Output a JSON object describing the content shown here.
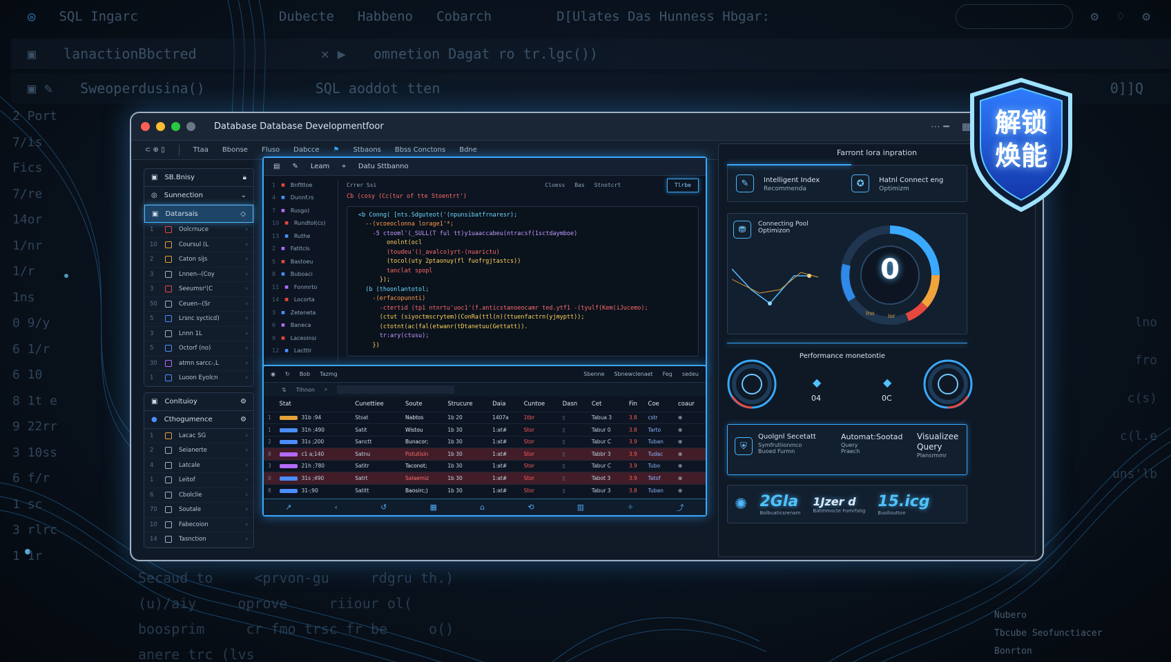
{
  "background": {
    "top_bar": [
      "SQL Ingarc",
      "Dubecte",
      "Habbeno",
      "Cobarch",
      "D[Ulates Das Hunness Hbgar:"
    ],
    "row1": "lanactionBbctred",
    "row1_code": "omnetion Dagat ro tr.lgc())",
    "row2": "Sweoperdusina()",
    "row2_code": "SQL aoddot tten",
    "row2_right": "0]]Q",
    "gutter": [
      "2  Port",
      "7/is",
      "Fics",
      "7/re",
      "14or",
      "1/nr",
      "1/r",
      "1ns",
      "0  9/y",
      "6  1/r",
      "6  10",
      "8  1t e",
      "9  22rr",
      "3  10ss",
      "6  f/r",
      "1  sc",
      "3  rlrc",
      "1  1r"
    ],
    "right_gutter": [
      "lno",
      "fro",
      "c(s)",
      "c(l.e",
      "uns'lb"
    ],
    "bottom_code": [
      [
        "Secaud to",
        "<prvon-gu",
        "rdgru th.)"
      ],
      [
        "(u)/aiy",
        "oprove",
        "riiour ol("
      ],
      [
        "boosprim",
        "cr fmo trsc fr be",
        "o()"
      ],
      [
        "",
        "anere trc (lvs",
        ""
      ]
    ],
    "bottom_right": [
      "Nubero",
      "Tbcube  Seofunctiacer",
      "Bonrton"
    ]
  },
  "window": {
    "title": "Database Database Developmentfoor",
    "toolbar": [
      "Ttaa",
      "Bbonse",
      "Fluso",
      "Dabcce",
      "Stbaons",
      "Bbss Conctons",
      "Bdne"
    ],
    "colors": {
      "close": "#ff5f57",
      "min": "#febc2e",
      "max": "#28c840",
      "accent": "#3aa9ff"
    }
  },
  "sidebar": {
    "header": "SB.Bnisy",
    "group1": "Sunnection",
    "group1_active": "Datarsais",
    "items": [
      {
        "n": "1",
        "label": "Oolcrnuce"
      },
      {
        "n": "10",
        "label": "Coursul (L"
      },
      {
        "n": "2",
        "label": "Caton sijs"
      },
      {
        "n": "3",
        "label": "Lnnen--(Coy"
      },
      {
        "n": "3",
        "label": "Seeumsr'(C"
      },
      {
        "n": "50",
        "label": "Ceuen--(Sr"
      },
      {
        "n": "5",
        "label": "Lrsnc sycticd)"
      },
      {
        "n": "3",
        "label": "Lnnn 1L"
      },
      {
        "n": "5",
        "label": "Octorf (no)"
      },
      {
        "n": "30",
        "label": "atmn sarcc-,L"
      },
      {
        "n": "1",
        "label": "Luoon Eyolcn"
      }
    ],
    "group2": "Conltuioy",
    "group3": "Cthogumence",
    "items2": [
      {
        "n": "1",
        "label": "Lacac SG"
      },
      {
        "n": "2",
        "label": "Seianerte"
      },
      {
        "n": "4",
        "label": "Latcale"
      },
      {
        "n": "1",
        "label": "Leitof"
      },
      {
        "n": "6",
        "label": "Cbolclie"
      },
      {
        "n": "70",
        "label": "Soutale"
      },
      {
        "n": "10",
        "label": "Fabecoion"
      },
      {
        "n": "14",
        "label": "Tasnction"
      }
    ]
  },
  "editor": {
    "tabs": [
      "Leam",
      "Datu Sttbanno"
    ],
    "files": [
      "Bnflttoe",
      "Dunnf.rs",
      "Rusgo)",
      "Rundtol(cs)",
      "Ruthe",
      "Fatitcls",
      "Bastoeu",
      "Buboaci",
      "Fonmrto",
      "Locorta",
      "Zeteneta",
      "Baneca",
      "Laceoinsi",
      "Lacttlr"
    ],
    "sub": [
      "Crrer Ssi",
      "Cloess",
      "Bas",
      "Stnotcrt"
    ],
    "run_label": "Tlrbe",
    "header_line": "Cb (cosy (Cc(tur of tte Stoentrt')",
    "code": [
      "<b Conng( [nts.Sdguteot('(npunsibatfrnaresr);",
      "  --(vcoeoclonna lorage1'*; ",
      "    -5 ctooml'(_SULL(T ful tt)y1uaaccabeu(ntracsf(1sctdaymboe)",
      "        onolnt(ocl",
      "        (toudeu'()_avalco)yrt-(nuarictu)",
      "        (tocol(uty 2ptaonuy(fl fuofrgjtastcs))",
      "        tanclat spopl",
      "      });",
      "  (b (thoonlantotol;",
      "    -(erfacopunnti)",
      "      -ctertid (tp1 ntnrtu'uoc1'(f.anticstanoeocamr ted.ytf1 -(tyulf(Kem(iJucemo);",
      "      (ctut (siyoctmscrytem)(ConRa(ttl(n)(ttuenfactrn(yjmyptt));",
      "      (ctotnt(ac(fal(etwanr(tDtanetuu(Gettatt)).",
      "      tr:ary(ctusu);",
      "    })"
    ]
  },
  "grid": {
    "bar": [
      "Bob",
      "Tazmg"
    ],
    "bar_right": [
      "Sbenne",
      "Sbnewclenaet",
      "Feg",
      "sedeu"
    ],
    "bar2": "Tlhnon",
    "headers": [
      "Stat",
      "Cunettiee",
      "Soute",
      "Strucure",
      "Daia",
      "Cuntoe",
      "Dasn",
      "Cet",
      "Fin",
      "Coe",
      "coaur"
    ],
    "rows": [
      {
        "n": "1",
        "bar": "#e5a23b",
        "a": "31b :94",
        "b": "Stsat",
        "c": "Nabtos",
        "d": "1b 20",
        "e": "1407a",
        "f": "1tbr",
        "g": "Tabua 3",
        "h": "3.8",
        "i": "cstr",
        "hl": false
      },
      {
        "n": "1",
        "bar": "#4c8dff",
        "a": "31h ;490",
        "b": "Satit",
        "c": "Wistou",
        "d": "1b 30",
        "e": "1:at#",
        "f": "Stor",
        "g": "Tabur 0",
        "h": "3.8",
        "i": "Tarto",
        "hl": false
      },
      {
        "n": "2",
        "bar": "#4c8dff",
        "a": "31s ;200",
        "b": "Sanctt",
        "c": "Bunacor;",
        "d": "1b 30",
        "e": "1:at#",
        "f": "Stor",
        "g": "Tabur C",
        "h": "3.9",
        "i": "Tuban",
        "hl": false
      },
      {
        "n": "8",
        "bar": "#b26bff",
        "a": "c1 a;140",
        "b": "Satnu",
        "c": "Fistutisin",
        "d": "1b 30",
        "e": "1:at#",
        "f": "Stor",
        "g": "Tabbr 3",
        "h": "3.9",
        "i": "Tudac",
        "hl": true
      },
      {
        "n": "3",
        "bar": "#b26bff",
        "a": "21h ;780",
        "b": "Satitr",
        "c": "Taconot;",
        "d": "1b 30",
        "e": "1:at#",
        "f": "Stor",
        "g": "Tabur C",
        "h": "3.9",
        "i": "Tubo",
        "hl": false
      },
      {
        "n": "0",
        "bar": "#4c8dff",
        "a": "31s ;490",
        "b": "Satrt",
        "c": "Salaemiz",
        "d": "1b 30",
        "e": "1:at#",
        "f": "Stor",
        "g": "Tabot 3",
        "h": "3.9",
        "i": "Tatof",
        "hl": true
      },
      {
        "n": "8",
        "bar": "#4c8dff",
        "a": "31-;90",
        "b": "Satitt",
        "c": "Baosirc;)",
        "d": "1b 30",
        "e": "1:at#",
        "f": "Stor",
        "g": "Tabur 3",
        "h": "3.8",
        "i": "Tuban",
        "hl": false
      }
    ]
  },
  "panel": {
    "title": "Farront lora inpration",
    "card1": {
      "label1": "Intelligent Index",
      "label2": "Recommenda"
    },
    "card2": {
      "label1": "Hatnl Connect eng",
      "label2": "Optimizm"
    },
    "pool": {
      "label1": "Connecting Pool",
      "label2": "Optimizon",
      "gauge_value": "0",
      "gauge_labels": [
        "Ino",
        "lor"
      ]
    },
    "perf_title": "Performance monetontie",
    "perf_vals": [
      "04",
      "0C"
    ],
    "features": [
      {
        "title": "Quolgnl Secetatt",
        "sub1": "Symfrutiionmco",
        "sub2": "Buoed Furmn"
      },
      {
        "title": "Automat:Sootad",
        "sub1": "Query",
        "sub2": "Praech"
      },
      {
        "title": "Visualizee",
        "sub1": "Query",
        "sub2": "Plansrmmr"
      }
    ],
    "stats": [
      {
        "value": "2Gla",
        "label": "Bolbuaticsrenam"
      },
      {
        "value": "1Jzer d",
        "label": "Batmmocte Fomrfstig"
      },
      {
        "value": "15.icg",
        "label": "Buolloutton"
      }
    ]
  },
  "badge": {
    "line1": "解锁",
    "line2": "焕能"
  }
}
